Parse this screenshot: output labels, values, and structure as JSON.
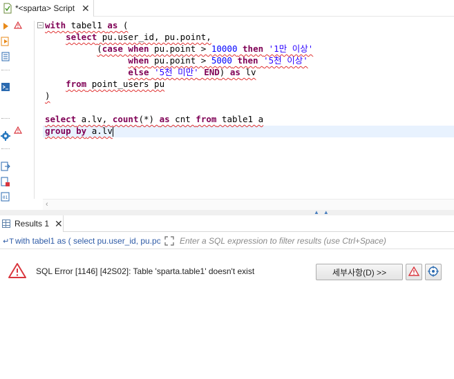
{
  "editor": {
    "tab_title": "*<sparta> Script",
    "tab_close": "✕",
    "fold_toggle": "−",
    "lines": [
      {
        "segments": [
          {
            "t": "with ",
            "c": "kw err"
          },
          {
            "t": "tabel1 ",
            "c": "err"
          },
          {
            "t": "as",
            "c": "kw err"
          },
          {
            "t": " (",
            "c": "err"
          }
        ]
      },
      {
        "segments": [
          {
            "t": "    "
          },
          {
            "t": "select",
            "c": "kw err"
          },
          {
            "t": " pu.user_id, pu.point,",
            "c": "err"
          }
        ]
      },
      {
        "segments": [
          {
            "t": "          "
          },
          {
            "t": "(",
            "c": "err"
          },
          {
            "t": "case when",
            "c": "kw err"
          },
          {
            "t": " pu.point > ",
            "c": "err"
          },
          {
            "t": "10000",
            "c": "num err"
          },
          {
            "t": " ",
            "c": "err"
          },
          {
            "t": "then",
            "c": "kw err"
          },
          {
            "t": " ",
            "c": "err"
          },
          {
            "t": "'1만 이상'",
            "c": "str err"
          }
        ]
      },
      {
        "segments": [
          {
            "t": "                "
          },
          {
            "t": "when",
            "c": "kw err"
          },
          {
            "t": " pu.point > ",
            "c": "err"
          },
          {
            "t": "5000",
            "c": "num err"
          },
          {
            "t": " ",
            "c": "err"
          },
          {
            "t": "then",
            "c": "kw err"
          },
          {
            "t": " ",
            "c": "err"
          },
          {
            "t": "'5천 이상'",
            "c": "str err"
          }
        ]
      },
      {
        "segments": [
          {
            "t": "                "
          },
          {
            "t": "else",
            "c": "kw err"
          },
          {
            "t": " ",
            "c": "err"
          },
          {
            "t": "'5천 미만'",
            "c": "str err"
          },
          {
            "t": " ",
            "c": "err"
          },
          {
            "t": "END",
            "c": "kw err"
          },
          {
            "t": ") ",
            "c": "err"
          },
          {
            "t": "as",
            "c": "kw err"
          },
          {
            "t": " lv",
            "c": "err"
          }
        ]
      },
      {
        "segments": [
          {
            "t": "    "
          },
          {
            "t": "from",
            "c": "kw err"
          },
          {
            "t": " point_users pu",
            "c": "err"
          }
        ]
      },
      {
        "segments": [
          {
            "t": ")",
            "c": "err"
          }
        ]
      },
      {
        "segments": []
      },
      {
        "segments": [
          {
            "t": "select",
            "c": "kw err"
          },
          {
            "t": " a.lv, ",
            "c": "err"
          },
          {
            "t": "count",
            "c": "kw err"
          },
          {
            "t": "(*) ",
            "c": "err"
          },
          {
            "t": "as",
            "c": "kw err"
          },
          {
            "t": " cnt ",
            "c": "err"
          },
          {
            "t": "from",
            "c": "kw err"
          },
          {
            "t": " table1 a",
            "c": "err"
          }
        ]
      },
      {
        "segments": [
          {
            "t": "group by",
            "c": "kw err"
          },
          {
            "t": " a.lv",
            "c": "err"
          }
        ]
      }
    ]
  },
  "results": {
    "tab_label": "Results 1",
    "tab_close": "✕",
    "query_prefix": "↵T",
    "query_text": "with tabel1 as ( select pu.user_id, pu.po",
    "filter_placeholder": "Enter a SQL expression to filter results (use Ctrl+Space)",
    "error_message": "SQL Error [1146] [42S02]: Table 'sparta.table1' doesn't exist",
    "details_button": "세부사항(D) >>"
  },
  "colors": {
    "keyword": "#7f0055",
    "number": "#0000ff",
    "string": "#2a00ff",
    "error_underline": "#e03030",
    "current_line": "#e8f2fe",
    "error_icon": "#d9363e",
    "query_link": "#2d5aa6"
  },
  "icons": {
    "editor_tab": "sql-script-icon",
    "toolbar": [
      "execute-statement-icon",
      "execute-script-icon",
      "explain-plan-icon",
      "output-console-icon",
      "settings-gear-icon",
      "export-icon",
      "file-error-icon",
      "file-binary-icon"
    ],
    "gutter": [
      "warning-icon",
      "warning-icon"
    ],
    "results": [
      "results-grid-icon",
      "expand-fullscreen-icon",
      "error-triangle-icon",
      "error-log-icon",
      "target-icon"
    ]
  }
}
